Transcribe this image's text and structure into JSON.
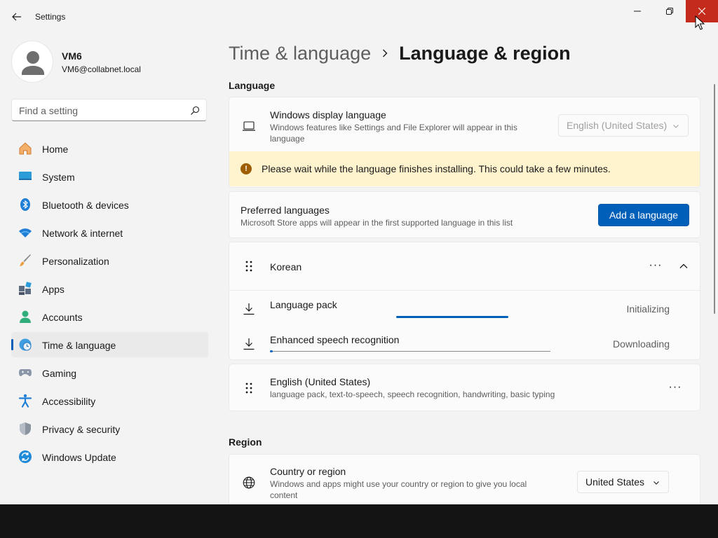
{
  "window": {
    "title": "Settings"
  },
  "profile": {
    "name": "VM6",
    "email": "VM6@collabnet.local"
  },
  "search": {
    "placeholder": "Find a setting"
  },
  "nav": {
    "items": [
      {
        "label": "Home",
        "icon": "home-icon",
        "active": false
      },
      {
        "label": "System",
        "icon": "system-icon",
        "active": false
      },
      {
        "label": "Bluetooth & devices",
        "icon": "bluetooth-icon",
        "active": false
      },
      {
        "label": "Network & internet",
        "icon": "network-icon",
        "active": false
      },
      {
        "label": "Personalization",
        "icon": "brush-icon",
        "active": false
      },
      {
        "label": "Apps",
        "icon": "apps-icon",
        "active": false
      },
      {
        "label": "Accounts",
        "icon": "accounts-icon",
        "active": false
      },
      {
        "label": "Time & language",
        "icon": "time-language-icon",
        "active": true
      },
      {
        "label": "Gaming",
        "icon": "gaming-icon",
        "active": false
      },
      {
        "label": "Accessibility",
        "icon": "accessibility-icon",
        "active": false
      },
      {
        "label": "Privacy & security",
        "icon": "shield-icon",
        "active": false
      },
      {
        "label": "Windows Update",
        "icon": "update-icon",
        "active": false
      }
    ]
  },
  "breadcrumb": {
    "parent": "Time & language",
    "current": "Language & region"
  },
  "language_section": {
    "heading": "Language",
    "display_language": {
      "title": "Windows display language",
      "description": "Windows features like Settings and File Explorer will appear in this language",
      "value": "English (United States)"
    },
    "warning": "Please wait while the language finishes installing. This could take a few minutes.",
    "preferred": {
      "title": "Preferred languages",
      "description": "Microsoft Store apps will appear in the first supported language in this list",
      "button": "Add a language"
    },
    "korean": {
      "name": "Korean",
      "more": "···",
      "language_pack": {
        "label": "Language pack",
        "status": "Initializing",
        "progress": 0.4
      },
      "speech": {
        "label": "Enhanced speech recognition",
        "status": "Downloading",
        "progress": 0.01
      }
    },
    "english": {
      "name": "English (United States)",
      "features": "language pack, text-to-speech, speech recognition, handwriting, basic typing",
      "more": "···"
    }
  },
  "region_section": {
    "heading": "Region",
    "country": {
      "title": "Country or region",
      "description": "Windows and apps might use your country or region to give you local content",
      "value": "United States"
    }
  },
  "colors": {
    "accent": "#005fb8",
    "close": "#c42b1c",
    "warning_bg": "#fff4ce",
    "warning_icon": "#9d5d00"
  }
}
